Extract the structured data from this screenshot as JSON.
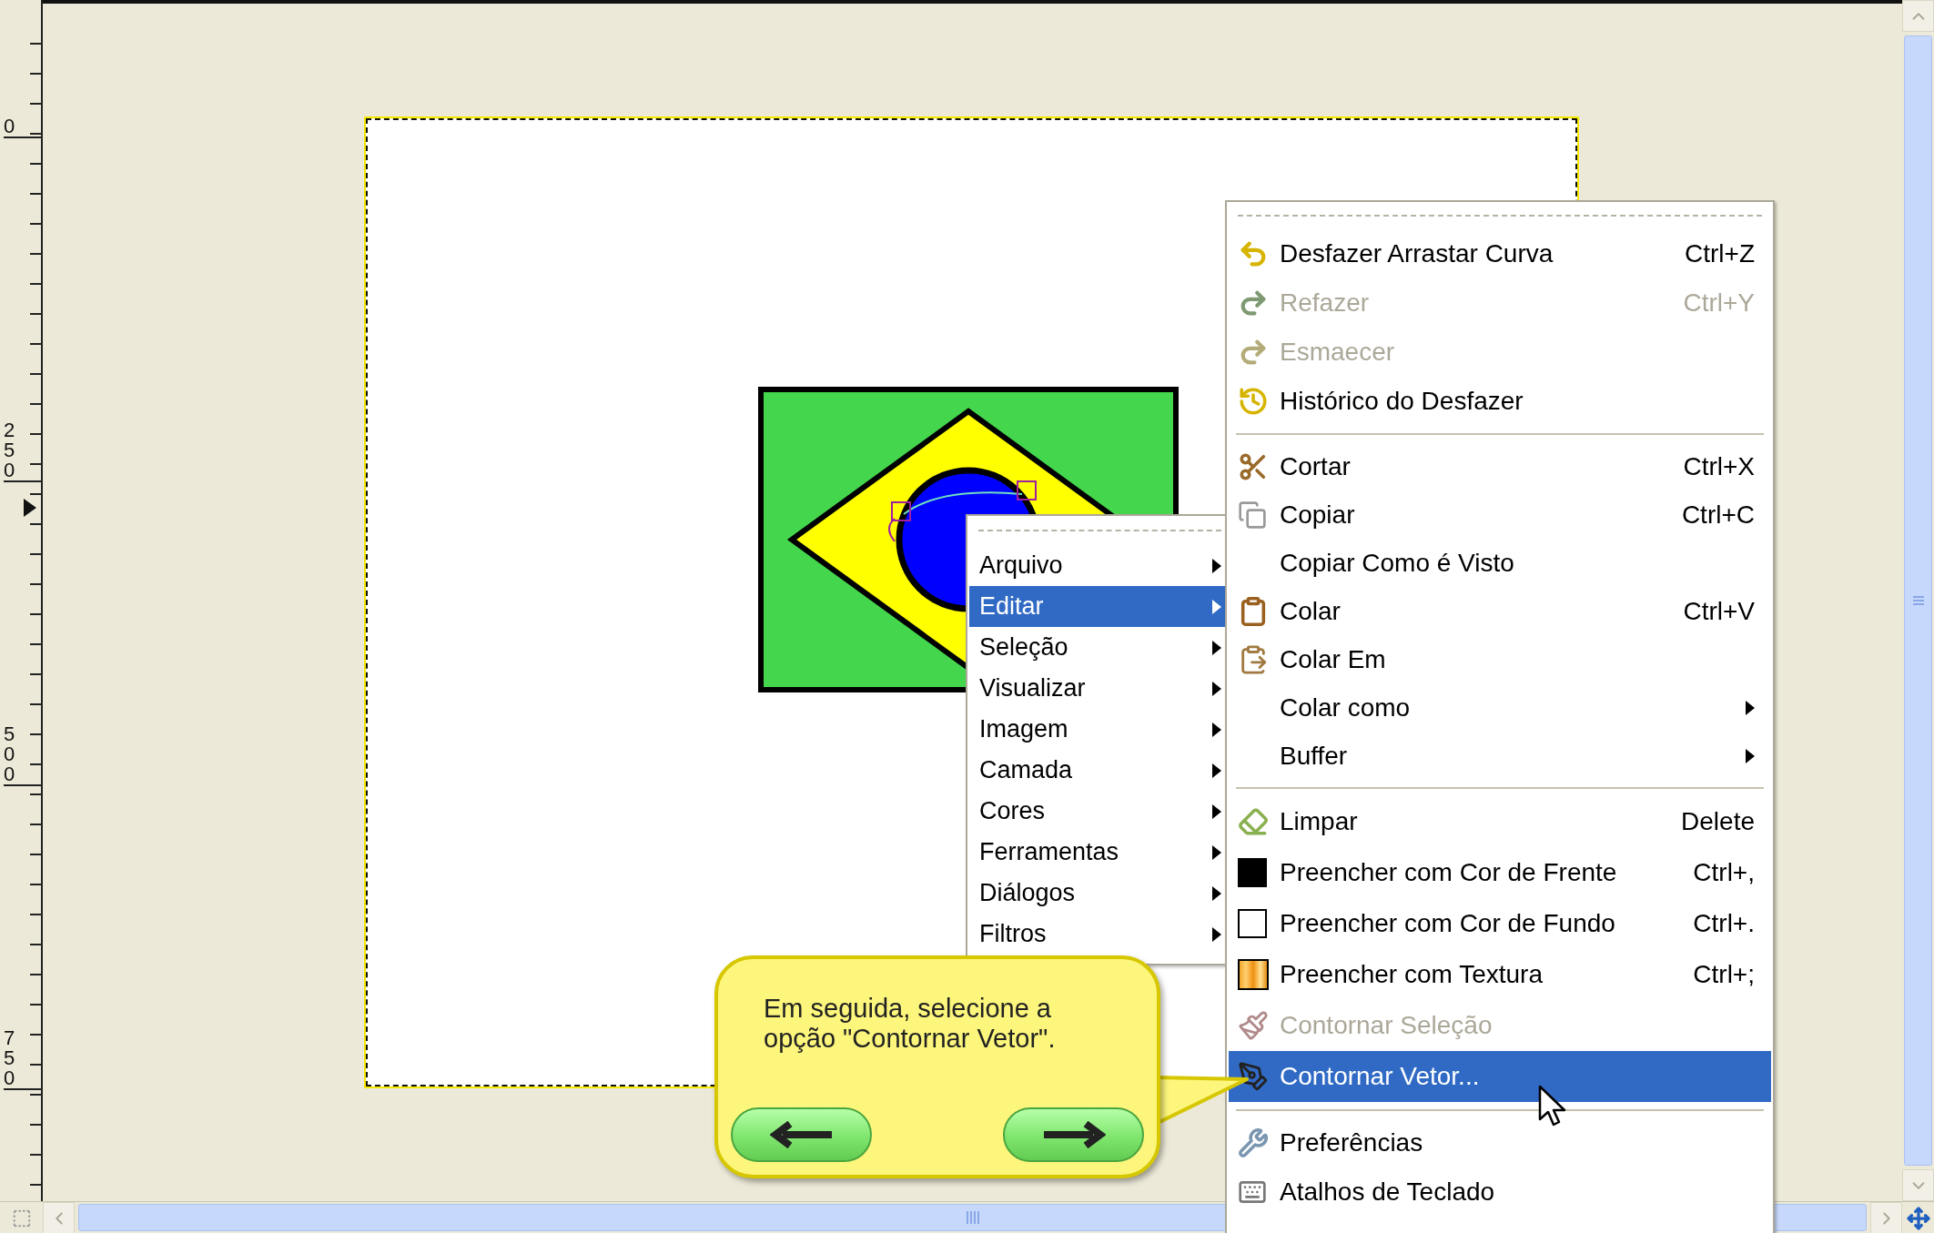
{
  "ruler": {
    "labels": [
      "0",
      "250",
      "500",
      "750"
    ]
  },
  "image_menu": {
    "items": [
      {
        "label": "Arquivo",
        "selected": false,
        "submenu": true
      },
      {
        "label": "Editar",
        "selected": true,
        "submenu": true
      },
      {
        "label": "Seleção",
        "selected": false,
        "submenu": true
      },
      {
        "label": "Visualizar",
        "selected": false,
        "submenu": true
      },
      {
        "label": "Imagem",
        "selected": false,
        "submenu": true
      },
      {
        "label": "Camada",
        "selected": false,
        "submenu": true
      },
      {
        "label": "Cores",
        "selected": false,
        "submenu": true
      },
      {
        "label": "Ferramentas",
        "selected": false,
        "submenu": true
      },
      {
        "label": "Diálogos",
        "selected": false,
        "submenu": true
      },
      {
        "label": "Filtros",
        "selected": false,
        "submenu": true
      }
    ]
  },
  "edit_menu": {
    "items": [
      {
        "kind": "item",
        "label": "Desfazer Arrastar Curva",
        "shortcut": "Ctrl+Z",
        "disabled": false,
        "selected": false,
        "submenu": false
      },
      {
        "kind": "item",
        "label": "Refazer",
        "shortcut": "Ctrl+Y",
        "disabled": true,
        "selected": false,
        "submenu": false
      },
      {
        "kind": "item",
        "label": "Esmaecer",
        "disabled": true,
        "selected": false,
        "submenu": false
      },
      {
        "kind": "item",
        "label": "Histórico do Desfazer",
        "disabled": false,
        "selected": false,
        "submenu": false
      },
      {
        "kind": "separator"
      },
      {
        "kind": "item",
        "label": "Cortar",
        "shortcut": "Ctrl+X",
        "disabled": false,
        "selected": false,
        "submenu": false
      },
      {
        "kind": "item",
        "label": "Copiar",
        "shortcut": "Ctrl+C",
        "disabled": false,
        "selected": false,
        "submenu": false
      },
      {
        "kind": "item",
        "label": "Copiar Como é Visto",
        "disabled": false,
        "selected": false,
        "submenu": false
      },
      {
        "kind": "item",
        "label": "Colar",
        "shortcut": "Ctrl+V",
        "disabled": false,
        "selected": false,
        "submenu": false
      },
      {
        "kind": "item",
        "label": "Colar Em",
        "disabled": false,
        "selected": false,
        "submenu": false
      },
      {
        "kind": "item",
        "label": "Colar como",
        "disabled": false,
        "selected": false,
        "submenu": true
      },
      {
        "kind": "item",
        "label": "Buffer",
        "disabled": false,
        "selected": false,
        "submenu": true
      },
      {
        "kind": "separator"
      },
      {
        "kind": "item",
        "label": "Limpar",
        "shortcut": "Delete",
        "disabled": false,
        "selected": false,
        "submenu": false
      },
      {
        "kind": "item",
        "label": "Preencher com Cor de Frente",
        "shortcut": "Ctrl+,",
        "disabled": false,
        "selected": false,
        "submenu": false
      },
      {
        "kind": "item",
        "label": "Preencher com Cor de Fundo",
        "shortcut": "Ctrl+.",
        "disabled": false,
        "selected": false,
        "submenu": false
      },
      {
        "kind": "item",
        "label": "Preencher com Textura",
        "shortcut": "Ctrl+;",
        "disabled": false,
        "selected": false,
        "submenu": false
      },
      {
        "kind": "item",
        "label": "Contornar Seleção",
        "disabled": true,
        "selected": false,
        "submenu": false
      },
      {
        "kind": "item",
        "label": "Contornar Vetor...",
        "disabled": false,
        "selected": true,
        "submenu": false
      },
      {
        "kind": "separator"
      },
      {
        "kind": "item",
        "label": "Preferências",
        "disabled": false,
        "selected": false,
        "submenu": false
      },
      {
        "kind": "item",
        "label": "Atalhos de Teclado",
        "disabled": false,
        "selected": false,
        "submenu": false
      }
    ]
  },
  "callout": {
    "text": "Em seguida, selecione a opção \"Contornar Vetor\"."
  }
}
